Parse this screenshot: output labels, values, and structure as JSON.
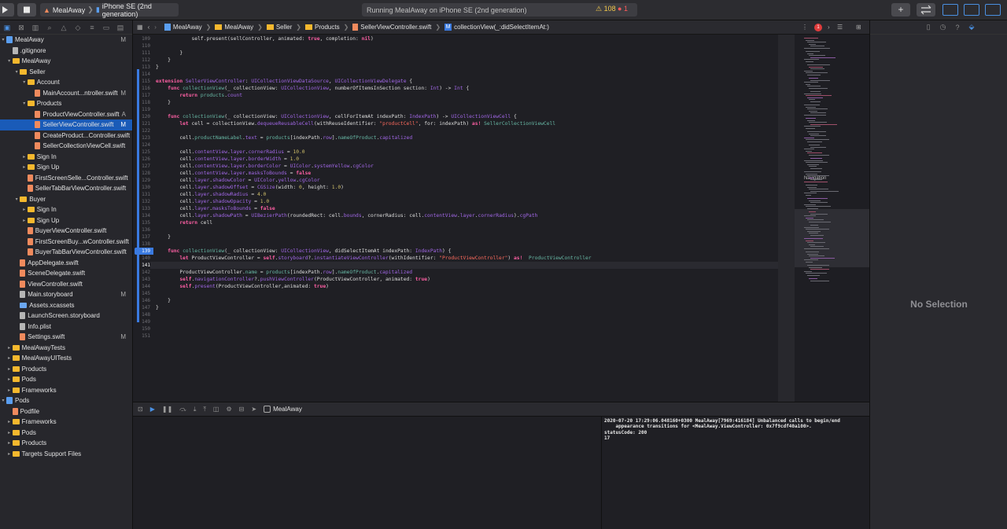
{
  "toolbar": {
    "scheme_name": "MealAway",
    "device_name": "iPhone SE (2nd generation)",
    "activity_text": "Running MealAway on iPhone SE (2nd generation)",
    "warning_count": "108",
    "error_count": "1",
    "play_icon": "play-icon",
    "stop_icon": "stop-icon",
    "add_label": "+",
    "accent_color": "#4a90e2"
  },
  "navigator": {
    "tabs": [
      "folder-icon",
      "source-control-icon",
      "symbol-icon",
      "find-icon",
      "issue-icon",
      "test-icon",
      "debug-icon",
      "breakpoint-icon",
      "report-icon"
    ],
    "rows": [
      {
        "label": "MealAway",
        "depth": 0,
        "icon": "proj",
        "disc": "▾",
        "badge": "M"
      },
      {
        "label": ".gitignore",
        "depth": 1,
        "icon": "other",
        "disc": "",
        "badge": ""
      },
      {
        "label": "MealAway",
        "depth": 1,
        "icon": "folder",
        "disc": "▾",
        "badge": ""
      },
      {
        "label": "Seller",
        "depth": 2,
        "icon": "folder",
        "disc": "▾",
        "badge": ""
      },
      {
        "label": "Account",
        "depth": 3,
        "icon": "folder",
        "disc": "▾",
        "badge": ""
      },
      {
        "label": "MainAccount...ntroller.swift",
        "depth": 4,
        "icon": "swift",
        "disc": "",
        "badge": "M"
      },
      {
        "label": "Products",
        "depth": 3,
        "icon": "folder",
        "disc": "▾",
        "badge": ""
      },
      {
        "label": "ProductViewController.swift",
        "depth": 4,
        "icon": "swift",
        "disc": "",
        "badge": "A"
      },
      {
        "label": "SellerViewController.swift",
        "depth": 4,
        "icon": "swift",
        "disc": "",
        "badge": "M",
        "selected": true
      },
      {
        "label": "CreateProduct...Controller.swift",
        "depth": 4,
        "icon": "swift",
        "disc": "",
        "badge": ""
      },
      {
        "label": "SellerCollectionViewCell.swift",
        "depth": 4,
        "icon": "swift",
        "disc": "",
        "badge": ""
      },
      {
        "label": "Sign In",
        "depth": 3,
        "icon": "folder",
        "disc": "▸",
        "badge": ""
      },
      {
        "label": "Sign Up",
        "depth": 3,
        "icon": "folder",
        "disc": "▸",
        "badge": ""
      },
      {
        "label": "FirstScreenSelle...Controller.swift",
        "depth": 3,
        "icon": "swift",
        "disc": "",
        "badge": ""
      },
      {
        "label": "SellerTabBarViewController.swift",
        "depth": 3,
        "icon": "swift",
        "disc": "",
        "badge": ""
      },
      {
        "label": "Buyer",
        "depth": 2,
        "icon": "folder",
        "disc": "▾",
        "badge": ""
      },
      {
        "label": "Sign In",
        "depth": 3,
        "icon": "folder",
        "disc": "▸",
        "badge": ""
      },
      {
        "label": "Sign Up",
        "depth": 3,
        "icon": "folder",
        "disc": "▸",
        "badge": ""
      },
      {
        "label": "BuyerViewController.swift",
        "depth": 3,
        "icon": "swift",
        "disc": "",
        "badge": ""
      },
      {
        "label": "FirstScreenBuy...wController.swift",
        "depth": 3,
        "icon": "swift",
        "disc": "",
        "badge": ""
      },
      {
        "label": "BuyerTabBarViewController.swift",
        "depth": 3,
        "icon": "swift",
        "disc": "",
        "badge": ""
      },
      {
        "label": "AppDelegate.swift",
        "depth": 2,
        "icon": "swift",
        "disc": "",
        "badge": ""
      },
      {
        "label": "SceneDelegate.swift",
        "depth": 2,
        "icon": "swift",
        "disc": "",
        "badge": ""
      },
      {
        "label": "ViewController.swift",
        "depth": 2,
        "icon": "swift",
        "disc": "",
        "badge": ""
      },
      {
        "label": "Main.storyboard",
        "depth": 2,
        "icon": "other",
        "disc": "",
        "badge": "M"
      },
      {
        "label": "Assets.xcassets",
        "depth": 2,
        "icon": "assets",
        "disc": "",
        "badge": ""
      },
      {
        "label": "LaunchScreen.storyboard",
        "depth": 2,
        "icon": "other",
        "disc": "",
        "badge": ""
      },
      {
        "label": "Info.plist",
        "depth": 2,
        "icon": "other",
        "disc": "",
        "badge": ""
      },
      {
        "label": "Settings.swift",
        "depth": 2,
        "icon": "swift",
        "disc": "",
        "badge": "M"
      },
      {
        "label": "MealAwayTests",
        "depth": 1,
        "icon": "folder",
        "disc": "▸",
        "badge": ""
      },
      {
        "label": "MealAwayUITests",
        "depth": 1,
        "icon": "folder",
        "disc": "▸",
        "badge": ""
      },
      {
        "label": "Products",
        "depth": 1,
        "icon": "folder",
        "disc": "▸",
        "badge": ""
      },
      {
        "label": "Pods",
        "depth": 1,
        "icon": "folder",
        "disc": "▸",
        "badge": ""
      },
      {
        "label": "Frameworks",
        "depth": 1,
        "icon": "folder",
        "disc": "▸",
        "badge": ""
      },
      {
        "label": "Pods",
        "depth": 0,
        "icon": "proj",
        "disc": "▾",
        "badge": ""
      },
      {
        "label": "Podfile",
        "depth": 1,
        "icon": "swift",
        "disc": "",
        "badge": ""
      },
      {
        "label": "Frameworks",
        "depth": 1,
        "icon": "folder",
        "disc": "▸",
        "badge": ""
      },
      {
        "label": "Pods",
        "depth": 1,
        "icon": "folder",
        "disc": "▸",
        "badge": ""
      },
      {
        "label": "Products",
        "depth": 1,
        "icon": "folder",
        "disc": "▸",
        "badge": ""
      },
      {
        "label": "Targets Support Files",
        "depth": 1,
        "icon": "folder",
        "disc": "▸",
        "badge": ""
      }
    ]
  },
  "jumpbar": {
    "crumbs": [
      "MealAway",
      "MealAway",
      "Seller",
      "Products",
      "SellerViewController.swift"
    ],
    "symbol_badge": "M",
    "symbol": "collectionView(_:didSelectItemAt:)",
    "issue_count": "1"
  },
  "editor": {
    "current_line": 141,
    "breakpoint_line": 139,
    "lines": [
      {
        "n": 109,
        "html": "            self.present(sellController, animated: <span class='kw'>true</span>, completion: <span class='kw'>nil</span>)"
      },
      {
        "n": 110,
        "html": ""
      },
      {
        "n": 111,
        "html": "        }"
      },
      {
        "n": 112,
        "html": "    }"
      },
      {
        "n": 113,
        "html": "}"
      },
      {
        "n": 114,
        "html": ""
      },
      {
        "n": 115,
        "html": "<span class='kw'>extension</span> <span class='ty'>SellerViewController</span>: <span class='ty'>UICollectionViewDataSource</span>, <span class='ty'>UICollectionViewDelegate</span> {"
      },
      {
        "n": 116,
        "html": "    <span class='kw'>func</span> <span class='fn'>collectionView</span>(_ collectionView: <span class='ty'>UICollectionView</span>, numberOfItemsInSection section: <span class='ty'>Int</span>) -> <span class='ty'>Int</span> {"
      },
      {
        "n": 117,
        "html": "        <span class='kw'>return</span> <span class='fn'>products</span>.<span class='ty'>count</span>"
      },
      {
        "n": 118,
        "html": "    }"
      },
      {
        "n": 119,
        "html": ""
      },
      {
        "n": 120,
        "html": "    <span class='kw'>func</span> <span class='fn'>collectionView</span>(_ collectionView: <span class='ty'>UICollectionView</span>, cellForItemAt indexPath: <span class='ty'>IndexPath</span>) -> <span class='ty'>UICollectionViewCell</span> {"
      },
      {
        "n": 121,
        "html": "        <span class='kw'>let</span> cell = collectionView.<span class='ty'>dequeueReusableCell</span>(withReuseIdentifier: <span class='str'>\"productCell\"</span>, for: indexPath) <span class='kw'>as!</span> <span class='fn'>SellerCollectionViewCell</span>"
      },
      {
        "n": 122,
        "html": ""
      },
      {
        "n": 123,
        "html": "        cell.<span class='fn'>productNameLabel</span>.<span class='ty'>text</span> = <span class='fn'>products</span>[indexPath.<span class='ty'>row</span>].<span class='fn'>nameOfProduct</span>.<span class='ty'>capitalized</span>"
      },
      {
        "n": 124,
        "html": ""
      },
      {
        "n": 125,
        "html": "        cell.<span class='ty'>contentView</span>.<span class='ty'>layer</span>.<span class='ty'>cornerRadius</span> = <span class='num'>10.0</span>"
      },
      {
        "n": 126,
        "html": "        cell.<span class='ty'>contentView</span>.<span class='ty'>layer</span>.<span class='ty'>borderWidth</span> = <span class='num'>1.0</span>"
      },
      {
        "n": 127,
        "html": "        cell.<span class='ty'>contentView</span>.<span class='ty'>layer</span>.<span class='ty'>borderColor</span> = <span class='ty'>UIColor</span>.<span class='ty'>systemYellow</span>.<span class='ty'>cgColor</span>"
      },
      {
        "n": 128,
        "html": "        cell.<span class='ty'>contentView</span>.<span class='ty'>layer</span>.<span class='ty'>masksToBounds</span> = <span class='kw'>false</span>"
      },
      {
        "n": 129,
        "html": "        cell.<span class='ty'>layer</span>.<span class='ty'>shadowColor</span> = <span class='ty'>UIColor</span>.<span class='ty'>yellow</span>.<span class='ty'>cgColor</span>"
      },
      {
        "n": 130,
        "html": "        cell.<span class='ty'>layer</span>.<span class='ty'>shadowOffset</span> = <span class='ty'>CGSize</span>(width: <span class='num'>0</span>, height: <span class='num'>1.0</span>)"
      },
      {
        "n": 131,
        "html": "        cell.<span class='ty'>layer</span>.<span class='ty'>shadowRadius</span> = <span class='num'>4.0</span>"
      },
      {
        "n": 132,
        "html": "        cell.<span class='ty'>layer</span>.<span class='ty'>shadowOpacity</span> = <span class='num'>1.0</span>"
      },
      {
        "n": 133,
        "html": "        cell.<span class='ty'>layer</span>.<span class='ty'>masksToBounds</span> = <span class='kw'>false</span>"
      },
      {
        "n": 134,
        "html": "        cell.<span class='ty'>layer</span>.<span class='ty'>shadowPath</span> = <span class='ty'>UIBezierPath</span>(roundedRect: cell.<span class='ty'>bounds</span>, cornerRadius: cell.<span class='ty'>contentView</span>.<span class='ty'>layer</span>.<span class='ty'>cornerRadius</span>).<span class='ty'>cgPath</span>"
      },
      {
        "n": 135,
        "html": "        <span class='kw'>return</span> cell"
      },
      {
        "n": 136,
        "html": ""
      },
      {
        "n": 137,
        "html": "    }"
      },
      {
        "n": 138,
        "html": ""
      },
      {
        "n": 139,
        "html": "    <span class='kw'>func</span> <span class='fn'>collectionView</span>(_ collectionView: <span class='ty'>UICollectionView</span>, didSelectItemAt indexPath: <span class='ty'>IndexPath</span>) {"
      },
      {
        "n": 140,
        "html": "        <span class='kw'>let</span> ProductViewController = <span class='kw'>self</span>.<span class='ty'>storyboard</span>?.<span class='ty'>instantiateViewController</span>(withIdentifier: <span class='str'>\"ProductViewController\"</span>) <span class='kw'>as!</span>  <span class='fn'>ProductViewController</span>"
      },
      {
        "n": 141,
        "html": ""
      },
      {
        "n": 142,
        "html": "        ProductViewController.<span class='fn'>name</span> = <span class='fn'>products</span>[indexPath.<span class='ty'>row</span>].<span class='fn'>nameOfProduct</span>.<span class='ty'>capitalized</span>"
      },
      {
        "n": 143,
        "html": "        <span class='kw'>self</span>.<span class='ty'>navigationController</span>?.<span class='ty'>pushViewController</span>(ProductViewController, animated: <span class='kw'>true</span>)"
      },
      {
        "n": 144,
        "html": "        <span class='kw'>self</span>.<span class='ty'>present</span>(ProductViewController,animated: <span class='kw'>true</span>)"
      },
      {
        "n": 145,
        "html": ""
      },
      {
        "n": 146,
        "html": "    }"
      },
      {
        "n": 147,
        "html": "}"
      },
      {
        "n": 148,
        "html": ""
      },
      {
        "n": 149,
        "html": ""
      },
      {
        "n": 150,
        "html": ""
      },
      {
        "n": 151,
        "html": ""
      }
    ]
  },
  "minimap": {
    "section_label": "Navigation"
  },
  "debug": {
    "target": "MealAway",
    "console_text": "2020-07-20 17:29:06.048160+0300 MealAway[7969:416184] Unbalanced calls to begin/end\n    appearance transitions for <MealAway.ViewController: 0x7f9cdf40a100>.\nstatusCode: 200\n17"
  },
  "inspector": {
    "empty_label": "No Selection"
  }
}
